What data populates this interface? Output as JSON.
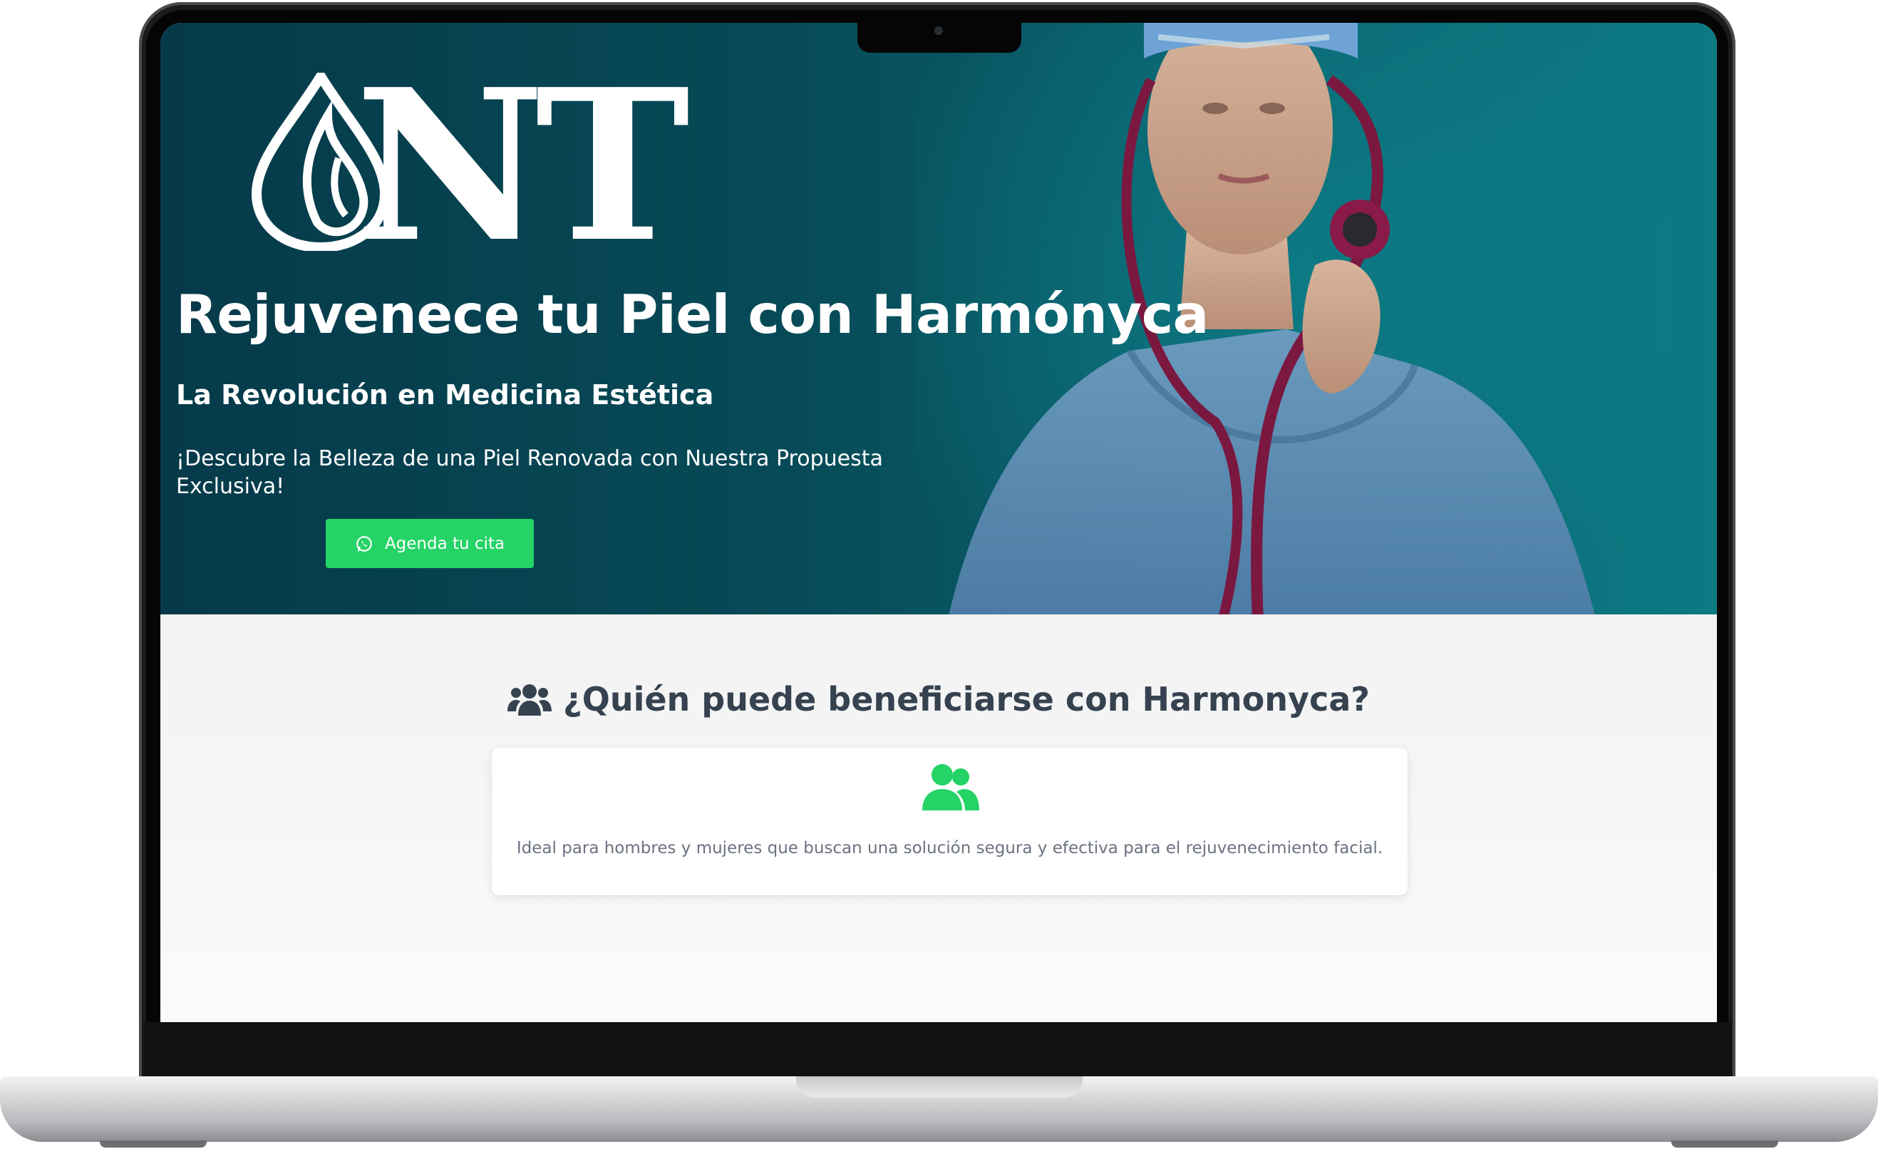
{
  "hero": {
    "logo_text": "NT",
    "title": "Rejuvenece tu Piel con Harmónyca",
    "subtitle": "La Revolución en Medicina Estética",
    "text": "¡Descubre la Belleza de una Piel Renovada con Nuestra Propuesta Exclusiva!",
    "cta_label": "Agenda tu cita",
    "cta_icon": "whatsapp-icon"
  },
  "benefits": {
    "heading": "¿Quién puede beneficiarse con Harmonyca?",
    "heading_icon": "users-icon",
    "card_icon": "user-group-icon",
    "card_text": "Ideal para hombres y mujeres que buscan una solución segura y efectiva para el rejuvenecimiento facial."
  },
  "colors": {
    "hero_bg": "#074a57",
    "accent_green": "#25d366",
    "heading_text": "#36424f"
  }
}
